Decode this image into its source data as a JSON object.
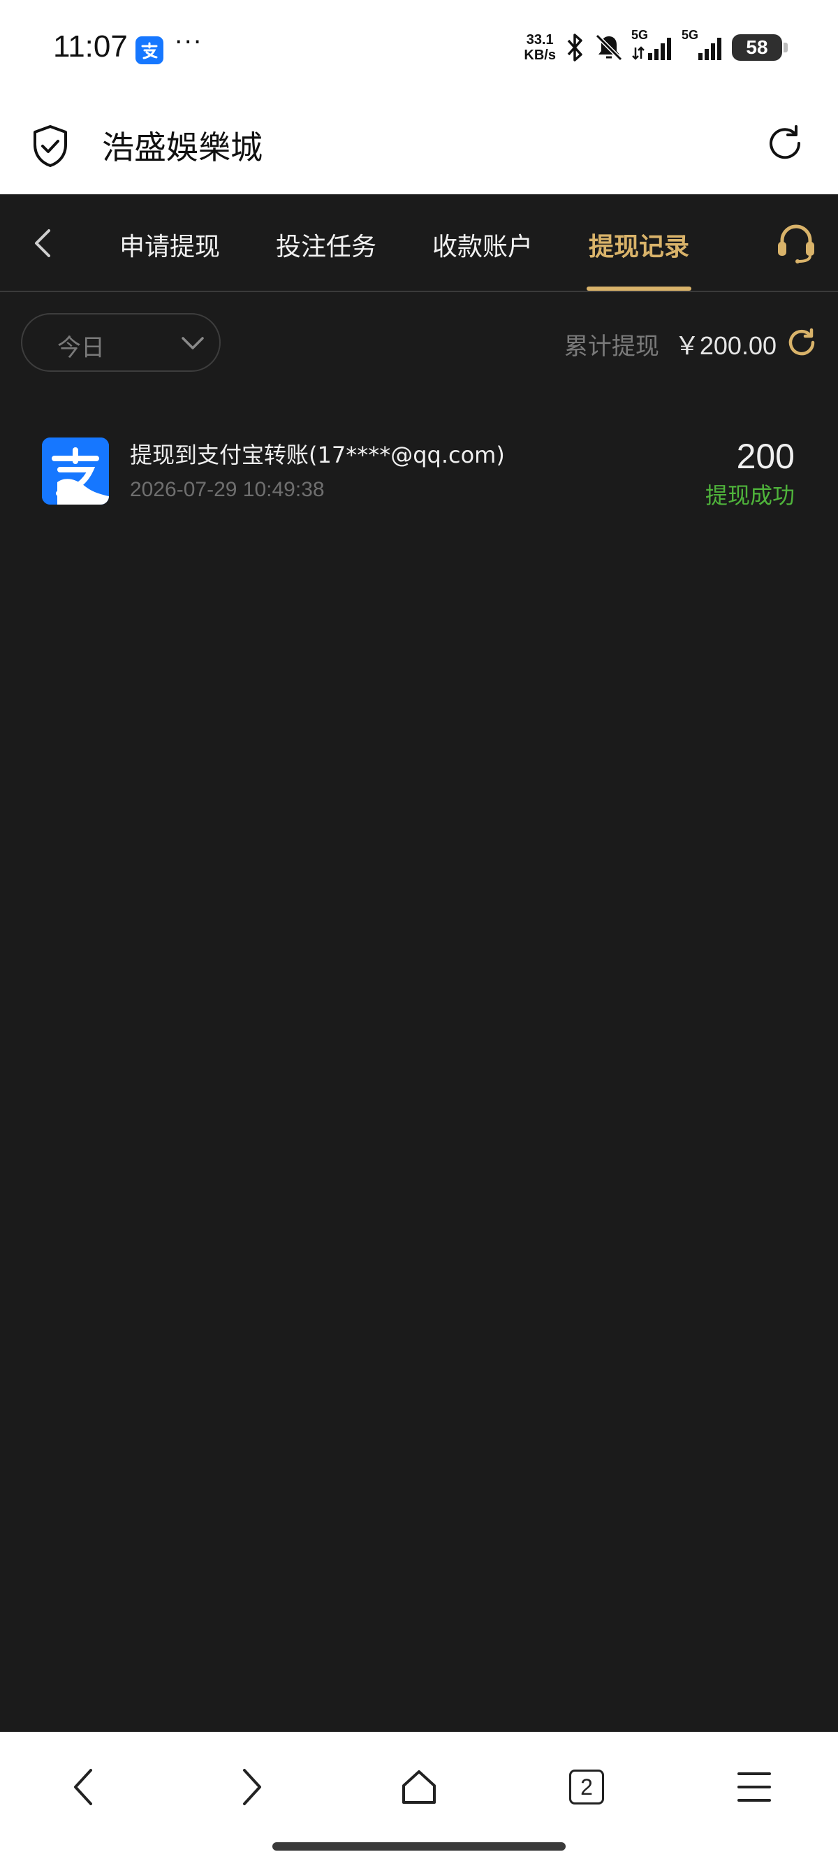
{
  "status_bar": {
    "time": "11:07",
    "dots": "···",
    "net_speed_value": "33.1",
    "net_speed_unit": "KB/s",
    "signal_1": "5G",
    "signal_2": "5G",
    "battery": "58"
  },
  "browser": {
    "page_title": "浩盛娛樂城",
    "tab_count": "2"
  },
  "tabs": [
    {
      "label": "申请提现",
      "active": false
    },
    {
      "label": "投注任务",
      "active": false
    },
    {
      "label": "收款账户",
      "active": false
    },
    {
      "label": "提现记录",
      "active": true
    }
  ],
  "filter": {
    "selected": "今日"
  },
  "summary": {
    "label": "累计提现",
    "value": "￥200.00"
  },
  "records": [
    {
      "title": "提现到支付宝转账(17****@qq.com)",
      "time": "2026-07-29 10:49:38",
      "amount": "200",
      "status": "提现成功"
    }
  ],
  "colors": {
    "background": "#1b1b1b",
    "accent_gold": "#d9b36a",
    "success_green": "#4fb33b",
    "alipay_blue": "#1677ff"
  }
}
